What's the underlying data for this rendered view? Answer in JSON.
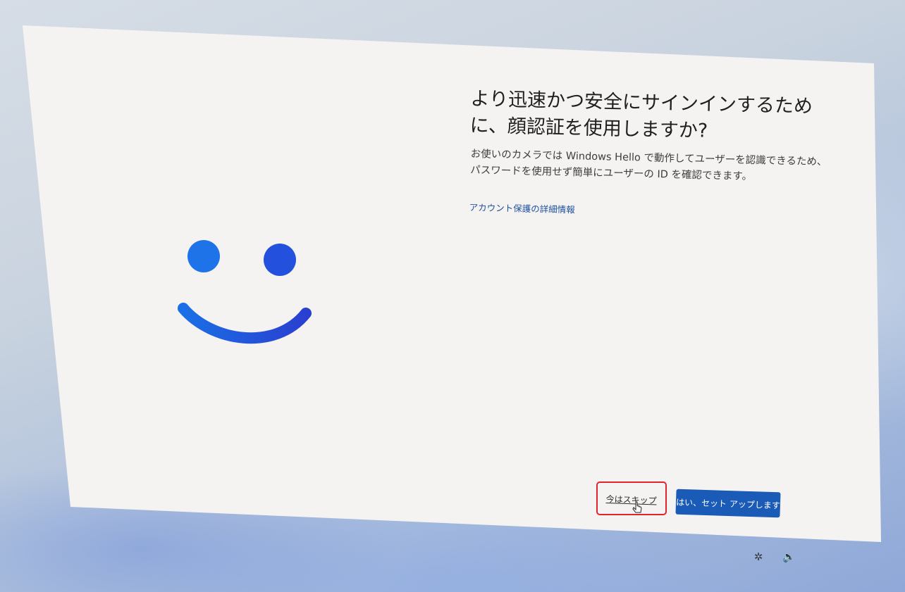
{
  "dialog": {
    "title": "より迅速かつ安全にサインインするために、顔認証を使用しますか?",
    "description": "お使いのカメラでは Windows Hello で動作してユーザーを認識できるため、パスワードを使用せず簡単にユーザーの ID を確認できます。",
    "link_label": "アカウント保護の詳細情報",
    "skip_label": "今はスキップ",
    "confirm_label": "はい、セット アップします"
  },
  "icons": {
    "face": "smiley-face-icon",
    "cursor": "mouse-pointer-icon",
    "accessibility": "accessibility-icon",
    "volume": "volume-icon"
  },
  "colors": {
    "accent": "#1b5bb8",
    "face_blue": "#2264e0",
    "highlight_box": "#e0242d",
    "dialog_bg": "#f5f3f1"
  }
}
